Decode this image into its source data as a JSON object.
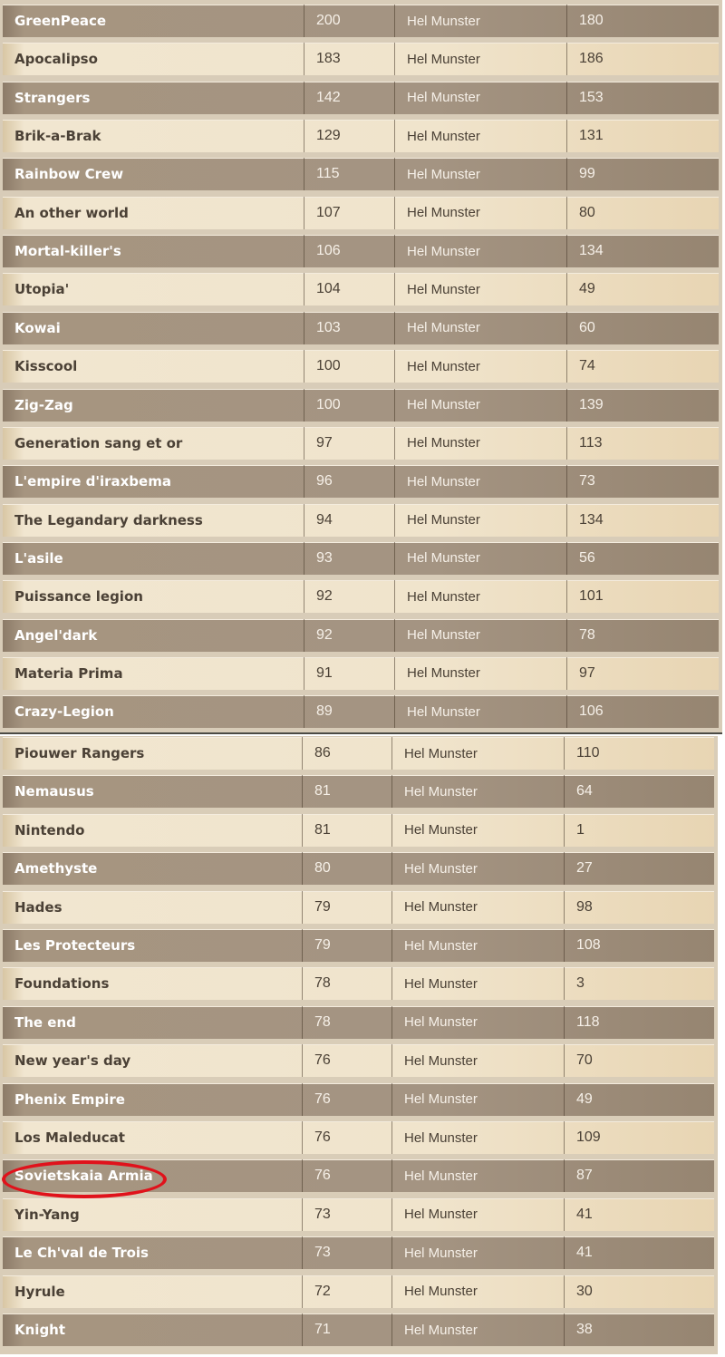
{
  "colors": {
    "dark_row": "#a49482",
    "light_row": "#f0e4cc",
    "highlight": "#e0121b"
  },
  "tables": [
    {
      "rows": [
        {
          "name": "GreenPeace",
          "score": "200",
          "owner": "Hel Munster",
          "value": "180"
        },
        {
          "name": "Apocalipso",
          "score": "183",
          "owner": "Hel Munster",
          "value": "186"
        },
        {
          "name": "Strangers",
          "score": "142",
          "owner": "Hel Munster",
          "value": "153"
        },
        {
          "name": "Brik-a-Brak",
          "score": "129",
          "owner": "Hel Munster",
          "value": "131"
        },
        {
          "name": "Rainbow Crew",
          "score": "115",
          "owner": "Hel Munster",
          "value": "99"
        },
        {
          "name": "An other world",
          "score": "107",
          "owner": "Hel Munster",
          "value": "80"
        },
        {
          "name": "Mortal-killer's",
          "score": "106",
          "owner": "Hel Munster",
          "value": "134"
        },
        {
          "name": "Utopia'",
          "score": "104",
          "owner": "Hel Munster",
          "value": "49"
        },
        {
          "name": "Kowai",
          "score": "103",
          "owner": "Hel Munster",
          "value": "60"
        },
        {
          "name": "Kisscool",
          "score": "100",
          "owner": "Hel Munster",
          "value": "74"
        },
        {
          "name": "Zig-Zag",
          "score": "100",
          "owner": "Hel Munster",
          "value": "139"
        },
        {
          "name": "Generation sang et or",
          "score": "97",
          "owner": "Hel Munster",
          "value": "113"
        },
        {
          "name": "L'empire d'iraxbema",
          "score": "96",
          "owner": "Hel Munster",
          "value": "73"
        },
        {
          "name": "The Legandary darkness",
          "score": "94",
          "owner": "Hel Munster",
          "value": "134"
        },
        {
          "name": "L'asile",
          "score": "93",
          "owner": "Hel Munster",
          "value": "56"
        },
        {
          "name": "Puissance legion",
          "score": "92",
          "owner": "Hel Munster",
          "value": "101"
        },
        {
          "name": "Angel'dark",
          "score": "92",
          "owner": "Hel Munster",
          "value": "78"
        },
        {
          "name": "Materia Prima",
          "score": "91",
          "owner": "Hel Munster",
          "value": "97"
        },
        {
          "name": "Crazy-Legion",
          "score": "89",
          "owner": "Hel Munster",
          "value": "106"
        }
      ]
    },
    {
      "rows": [
        {
          "name": "Piouwer Rangers",
          "score": "86",
          "owner": "Hel Munster",
          "value": "110"
        },
        {
          "name": "Nemausus",
          "score": "81",
          "owner": "Hel Munster",
          "value": "64"
        },
        {
          "name": "Nintendo",
          "score": "81",
          "owner": "Hel Munster",
          "value": "1"
        },
        {
          "name": "Amethyste",
          "score": "80",
          "owner": "Hel Munster",
          "value": "27"
        },
        {
          "name": "Hades",
          "score": "79",
          "owner": "Hel Munster",
          "value": "98"
        },
        {
          "name": "Les Protecteurs",
          "score": "79",
          "owner": "Hel Munster",
          "value": "108"
        },
        {
          "name": "Foundations",
          "score": "78",
          "owner": "Hel Munster",
          "value": "3"
        },
        {
          "name": "The end",
          "score": "78",
          "owner": "Hel Munster",
          "value": "118"
        },
        {
          "name": "New year's day",
          "score": "76",
          "owner": "Hel Munster",
          "value": "70"
        },
        {
          "name": "Phenix Empire",
          "score": "76",
          "owner": "Hel Munster",
          "value": "49"
        },
        {
          "name": "Los Maleducat",
          "score": "76",
          "owner": "Hel Munster",
          "value": "109"
        },
        {
          "name": "Sovietskaia Armia",
          "score": "76",
          "owner": "Hel Munster",
          "value": "87",
          "highlighted": true
        },
        {
          "name": "Yin-Yang",
          "score": "73",
          "owner": "Hel Munster",
          "value": "41"
        },
        {
          "name": "Le Ch'val de Trois",
          "score": "73",
          "owner": "Hel Munster",
          "value": "41"
        },
        {
          "name": "Hyrule",
          "score": "72",
          "owner": "Hel Munster",
          "value": "30"
        },
        {
          "name": "Knight",
          "score": "71",
          "owner": "Hel Munster",
          "value": "38"
        }
      ]
    }
  ]
}
